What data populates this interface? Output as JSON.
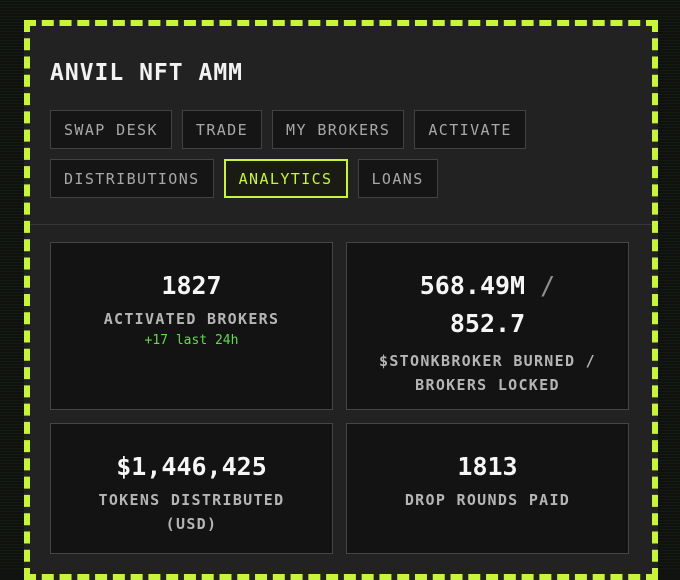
{
  "app": {
    "title": "ANVIL NFT AMM"
  },
  "nav": {
    "tabs": [
      {
        "label": "SWAP DESK",
        "active": false
      },
      {
        "label": "TRADE",
        "active": false
      },
      {
        "label": "MY BROKERS",
        "active": false
      },
      {
        "label": "ACTIVATE",
        "active": false
      },
      {
        "label": "DISTRIBUTIONS",
        "active": false
      },
      {
        "label": "ANALYTICS",
        "active": true
      },
      {
        "label": "LOANS",
        "active": false
      }
    ]
  },
  "stats": {
    "activated": {
      "value": "1827",
      "label": "ACTIVATED BROKERS",
      "delta": "+17 last 24h"
    },
    "burned": {
      "value_a": "568.49M",
      "separator": "/",
      "value_b": "852.7",
      "label": "$STONKBROKER BURNED / BROKERS LOCKED"
    },
    "distributed": {
      "value": "$1,446,425",
      "label": "TOKENS DISTRIBUTED (USD)"
    },
    "rounds": {
      "value": "1813",
      "label": "DROP ROUNDS PAID"
    }
  },
  "colors": {
    "accent": "#c8f53c",
    "positive": "#63d94f",
    "panel": "#222222",
    "card": "#131313"
  }
}
